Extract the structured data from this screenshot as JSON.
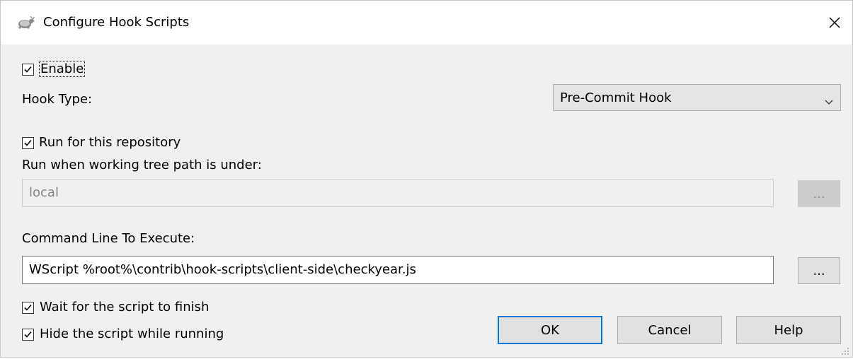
{
  "window": {
    "title": "Configure Hook Scripts",
    "app_icon": "tortoise-icon",
    "close_icon": "close-icon"
  },
  "enable": {
    "label": "Enable",
    "checked": true
  },
  "hook_type": {
    "label": "Hook Type:",
    "value": "Pre-Commit Hook"
  },
  "repo": {
    "run_for_label": "Run for this repository",
    "run_for_checked": true,
    "path_label": "Run when working tree path is under:",
    "path_value": "local",
    "browse_label": "..."
  },
  "command": {
    "label": "Command Line To Execute:",
    "value": "WScript %root%\\contrib\\hook-scripts\\client-side\\checkyear.js",
    "browse_label": "..."
  },
  "options": {
    "wait_label": "Wait for the script to finish",
    "wait_checked": true,
    "hide_label": "Hide the script while running",
    "hide_checked": true
  },
  "buttons": {
    "ok": "OK",
    "cancel": "Cancel",
    "help": "Help"
  }
}
